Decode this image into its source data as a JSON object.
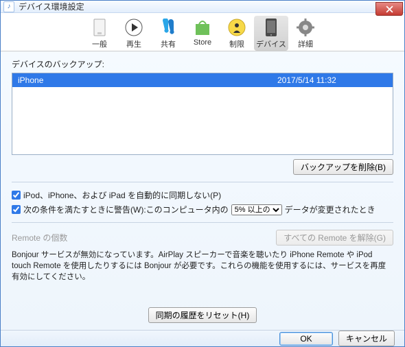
{
  "titlebar": {
    "title": "デバイス環境設定"
  },
  "tabs": {
    "general": "一般",
    "playback": "再生",
    "sharing": "共有",
    "store": "Store",
    "restrictions": "制限",
    "devices": "デバイス",
    "advanced": "詳細"
  },
  "backup": {
    "label": "デバイスのバックアップ:",
    "rows": [
      {
        "name": "iPhone",
        "date": "2017/5/14 11:32"
      }
    ],
    "delete_btn": "バックアップを削除(B)"
  },
  "options": {
    "no_autosync": "iPod、iPhone、および iPad を自動的に同期しない(P)",
    "warn_prefix": "次の条件を満たすときに警告(W):このコンピュータ内の",
    "warn_suffix": "データが変更されたとき",
    "threshold_options": [
      "5% 以上の"
    ],
    "threshold_selected": "5% 以上の"
  },
  "remote": {
    "label": "Remote の個数",
    "release_btn": "すべての Remote を解除(G)",
    "bonjour_msg": "Bonjour サービスが無効になっています。AirPlay スピーカーで音楽を聴いたり iPhone Remote や iPod touch Remote を使用したりするには Bonjour が必要です。これらの機能を使用するには、サービスを再度有効にしてください。"
  },
  "reset_btn": "同期の履歴をリセット(H)",
  "footer": {
    "ok": "OK",
    "cancel": "キャンセル"
  }
}
